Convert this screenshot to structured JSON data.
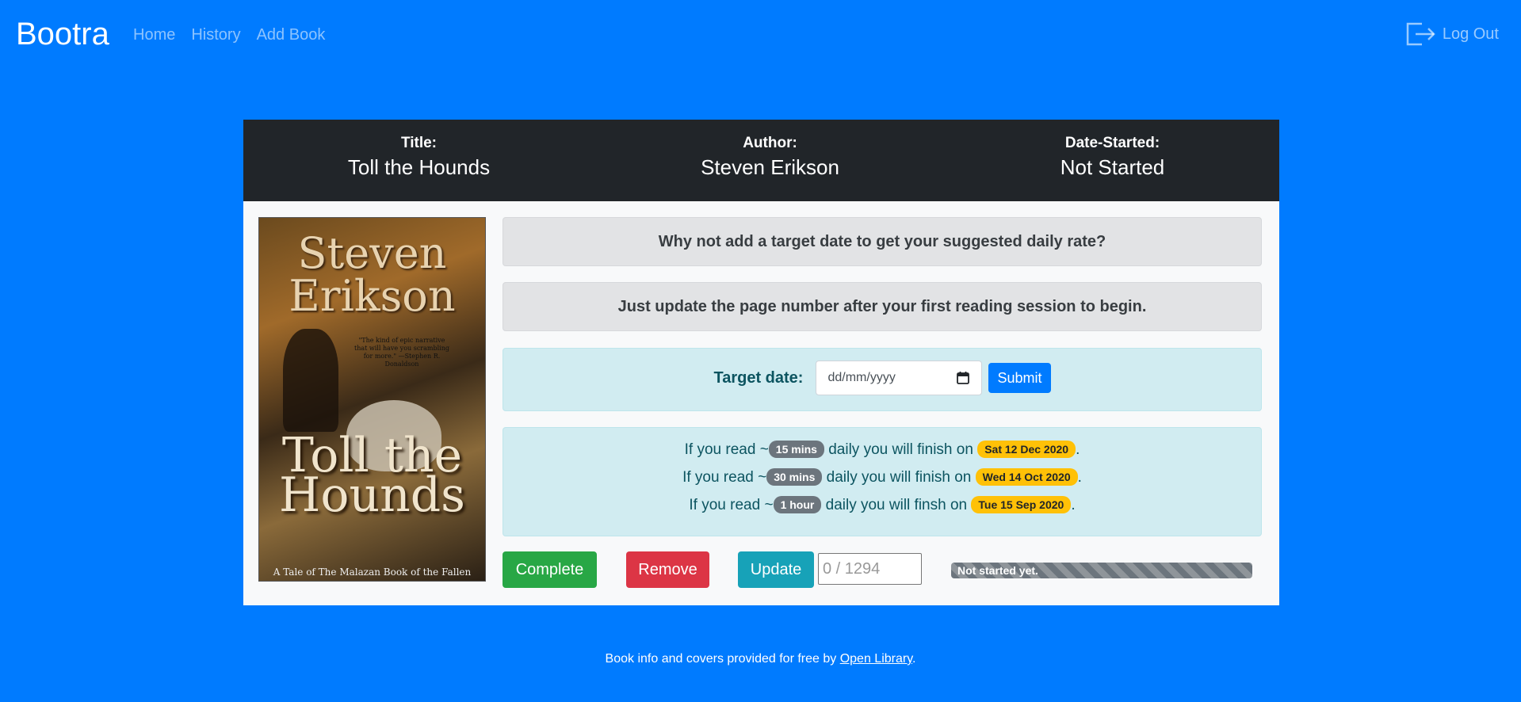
{
  "nav": {
    "brand": "Bootra",
    "links": [
      "Home",
      "History",
      "Add Book"
    ],
    "logout": "Log Out"
  },
  "book": {
    "title_label": "Title:",
    "title": "Toll the Hounds",
    "author_label": "Author:",
    "author": "Steven Erikson",
    "date_label": "Date-Started:",
    "date_started": "Not Started",
    "cover": {
      "author_text": "Steven Erikson",
      "quote": "\"The kind of epic narrative that will have you scrambling for more.\" —Stephen R. Donaldson",
      "title_text": "Toll the Hounds",
      "series": "A Tale of The Malazan Book of the Fallen"
    }
  },
  "alerts": {
    "target_hint": "Why not add a target date to get your suggested daily rate?",
    "update_hint": "Just update the page number after your first reading session to begin."
  },
  "target": {
    "label": "Target date:",
    "placeholder": "dd/mm/yyyy",
    "submit": "Submit"
  },
  "rates": [
    {
      "prefix": "If you read ~",
      "amount": "15 mins",
      "middle": " daily you will finish on ",
      "date": "Sat 12 Dec 2020",
      "suffix": "."
    },
    {
      "prefix": "If you read ~",
      "amount": "30 mins",
      "middle": " daily you will finish on ",
      "date": "Wed 14 Oct 2020",
      "suffix": "."
    },
    {
      "prefix": "If you read ~",
      "amount": "1 hour",
      "middle": " daily you will finsh on ",
      "date": "Tue 15 Sep 2020",
      "suffix": "."
    }
  ],
  "actions": {
    "complete": "Complete",
    "remove": "Remove",
    "update": "Update",
    "page_placeholder": "0 / 1294"
  },
  "progress": {
    "label": "Not started yet.",
    "value": 0
  },
  "footer": {
    "text": "Book info and covers provided for free by ",
    "link": "Open Library",
    "end": "."
  },
  "colors": {
    "background": "#007bff",
    "header": "#212529",
    "complete": "#28a745",
    "remove": "#dc3545",
    "update": "#17a2b8",
    "badge_date": "#ffc107"
  }
}
